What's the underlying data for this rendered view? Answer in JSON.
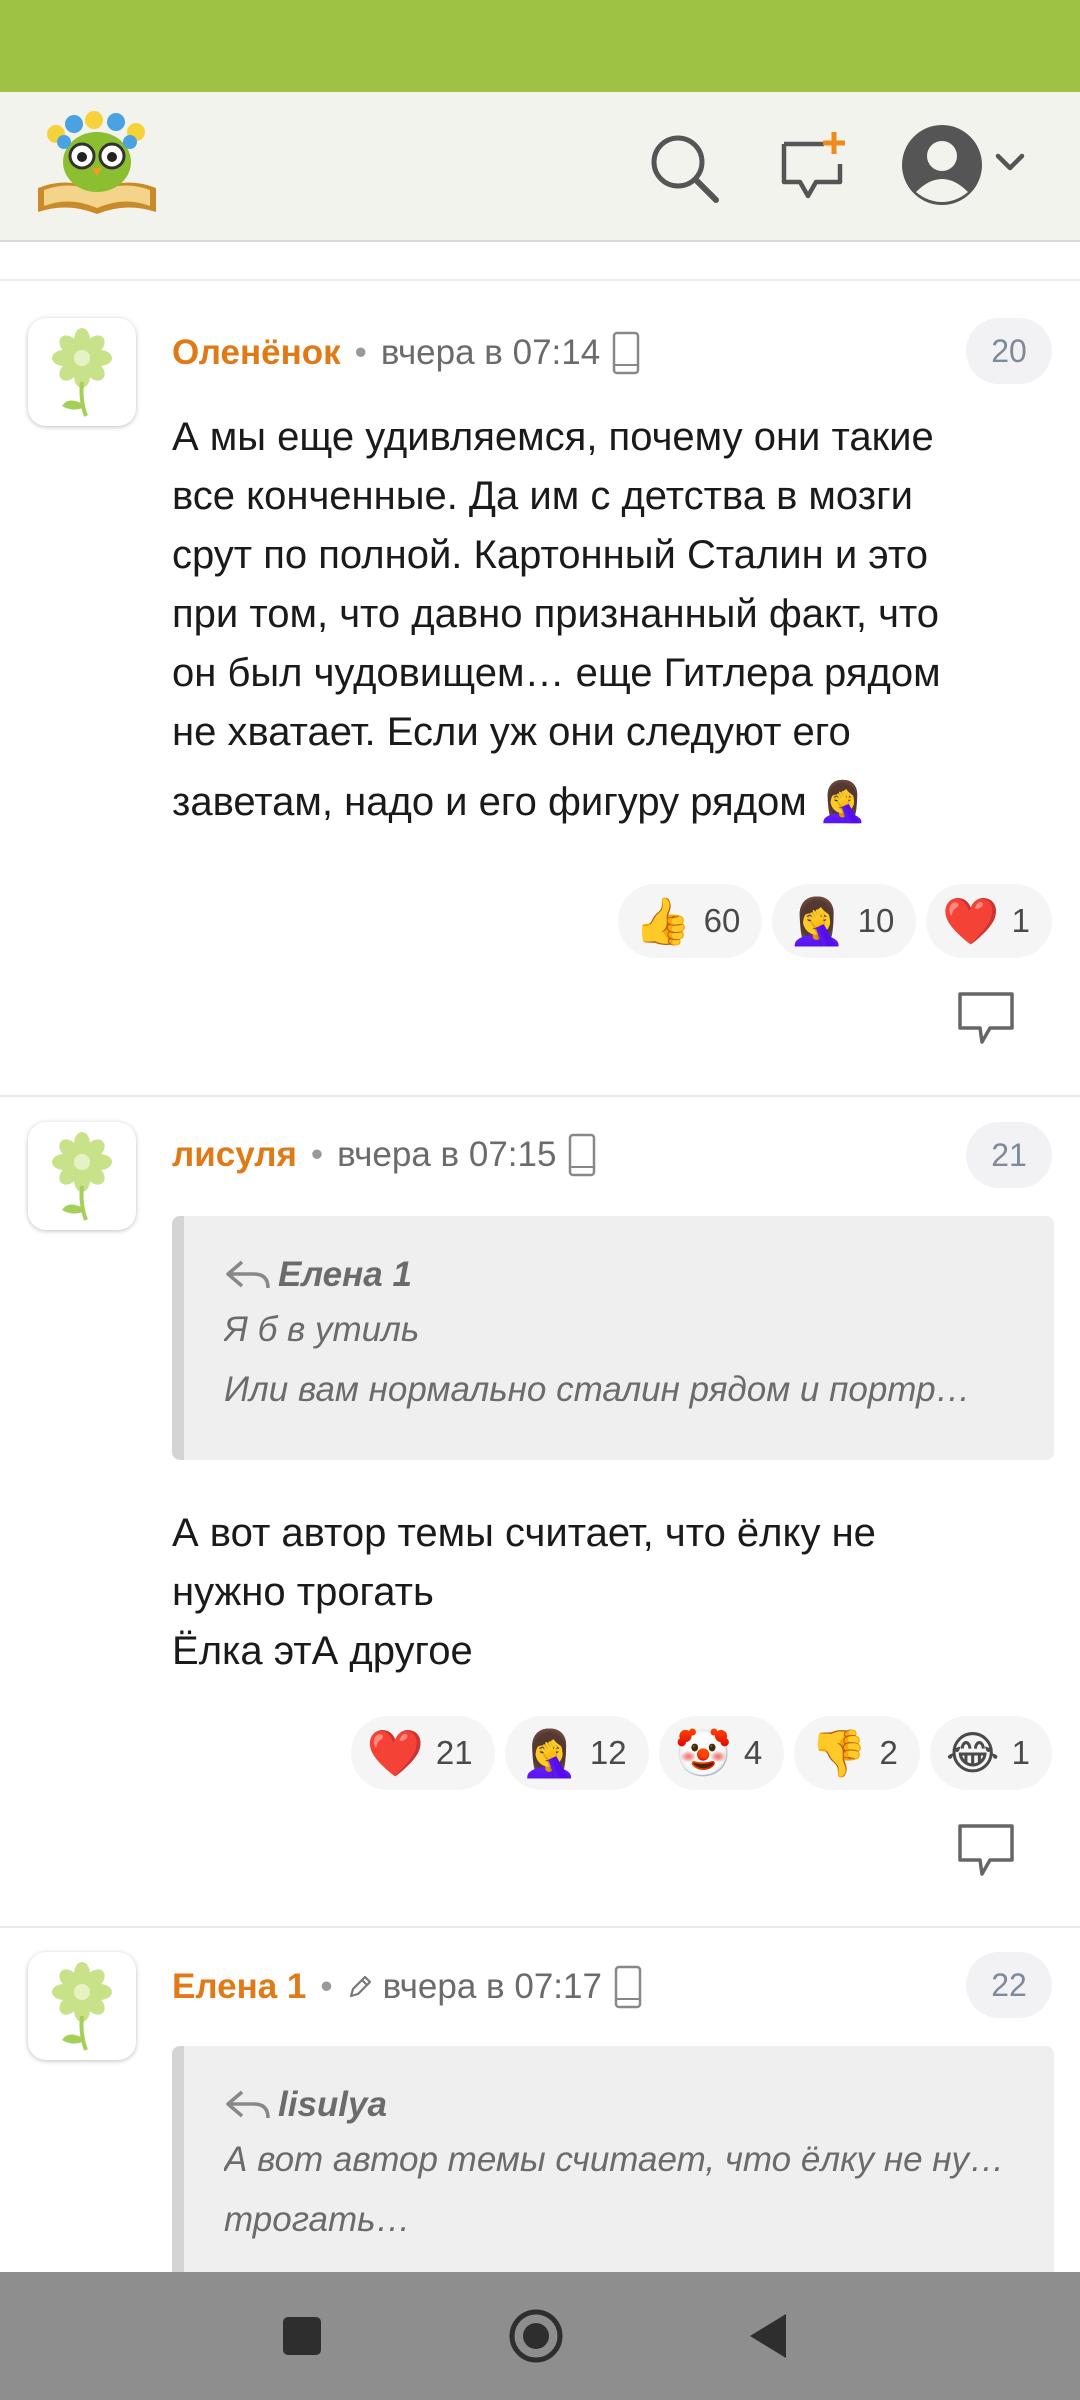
{
  "header": {
    "logo": "owl-on-book-logo",
    "icons": [
      "search-icon",
      "new-post-icon",
      "user-avatar-icon",
      "chevron-down-icon"
    ]
  },
  "comments": [
    {
      "author": "Оленёнок",
      "time": "вчера в 07:14",
      "number": "20",
      "edited": false,
      "text": [
        "А мы еще удивляемся, почему они такие",
        "все конченные. Да им с детства в мозги",
        "срут по полной. Картонный Сталин и это",
        "при том, что давно признанный факт, что",
        "он был чудовищем… еще Гитлера рядом",
        "не хватает. Если уж они следуют его",
        "заветам, надо и его фигуру рядом 🤦‍♀️"
      ],
      "reactions": [
        {
          "emoji": "👍",
          "count": "60"
        },
        {
          "emoji": "🤦‍♀️",
          "count": "10"
        },
        {
          "emoji": "❤️",
          "count": "1"
        }
      ]
    },
    {
      "author": "лисуля",
      "time": "вчера в 07:15",
      "number": "21",
      "edited": false,
      "quote": {
        "author": "Елена 1",
        "lines": [
          "Я б в утиль",
          "Или вам нормально сталин рядом и портр…"
        ]
      },
      "text": [
        "А вот автор темы считает, что ёлку не",
        "нужно трогать",
        "Ёлка этА другое"
      ],
      "reactions": [
        {
          "emoji": "❤️",
          "count": "21"
        },
        {
          "emoji": "🤦‍♀️",
          "count": "12"
        },
        {
          "emoji": "🤡",
          "count": "4"
        },
        {
          "emoji": "👎",
          "count": "2"
        },
        {
          "emoji": "😂",
          "count": "1"
        }
      ]
    },
    {
      "author": "Елена 1",
      "time": "вчера в 07:17",
      "number": "22",
      "edited": true,
      "quote": {
        "author": "lisulya",
        "lines": [
          "А вот автор темы считает, что ёлку не нужно",
          "трогать…"
        ]
      }
    }
  ],
  "navbar": {
    "icons": [
      "recent-apps-icon",
      "home-icon",
      "back-icon"
    ]
  }
}
